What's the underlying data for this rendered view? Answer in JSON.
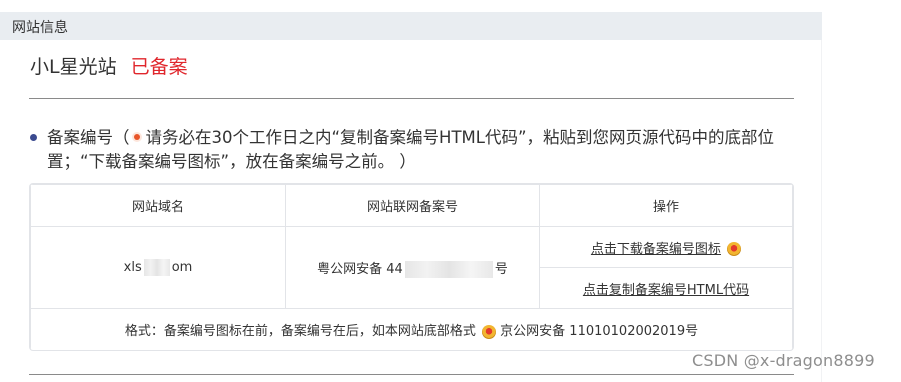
{
  "panel": {
    "header_title": "网站信息"
  },
  "site": {
    "name": "小L星光站",
    "status": "已备案",
    "status_color": "#e0262c"
  },
  "notice": {
    "prefix": "备案编号（",
    "text": "请务必在30个工作日之内“复制备案编号HTML代码”，粘贴到您网页源代码中的底部位置；“下载备案编号图标”，放在备案编号之前。 ）"
  },
  "table": {
    "headers": [
      "网站域名",
      "网站联网备案号",
      "操作"
    ],
    "domain_start": "xls",
    "domain_end": "om",
    "record_prefix": "粤公网安备 44",
    "record_suffix": "号",
    "actions": {
      "download_icon": "点击下载备案编号图标",
      "copy_html": "点击复制备案编号HTML代码"
    },
    "format_prefix": "格式：备案编号图标在前，备案编号在后，如本网站底部格式",
    "format_example": "京公网安备 11010102002019号"
  },
  "watermark": "CSDN @x-dragon8899",
  "icons": {
    "police_badge": "police-badge-icon",
    "warning": "warning-dot-icon",
    "bullet": "bullet-dot-icon"
  }
}
